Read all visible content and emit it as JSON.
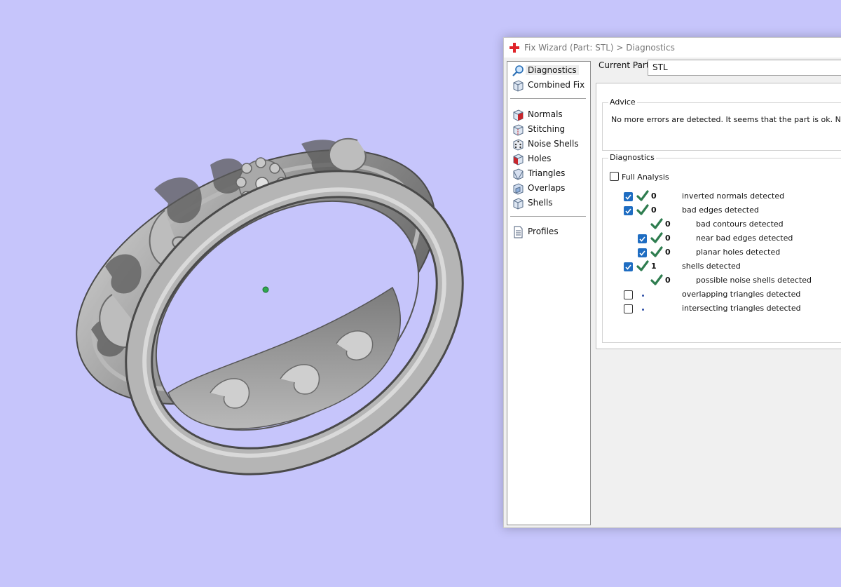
{
  "window": {
    "title": "Fix Wizard (Part: STL) > Diagnostics",
    "title_icon": "red-cross-icon"
  },
  "nav": {
    "items": [
      {
        "label": "Diagnostics",
        "icon": "magnifier-icon",
        "selected": true
      },
      {
        "label": "Combined Fix",
        "icon": "cube-icon",
        "selected": false
      },
      {
        "label": "Normals",
        "icon": "cube-red-face-icon",
        "selected": false
      },
      {
        "label": "Stitching",
        "icon": "cube-stitch-icon",
        "selected": false
      },
      {
        "label": "Noise Shells",
        "icon": "dice-icon",
        "selected": false
      },
      {
        "label": "Holes",
        "icon": "cube-hole-icon",
        "selected": false
      },
      {
        "label": "Triangles",
        "icon": "triangle-cube-icon",
        "selected": false
      },
      {
        "label": "Overlaps",
        "icon": "overlap-cube-icon",
        "selected": false
      },
      {
        "label": "Shells",
        "icon": "shell-cube-icon",
        "selected": false
      },
      {
        "label": "Profiles",
        "icon": "document-icon",
        "selected": false
      }
    ]
  },
  "current_part": {
    "label": "Current Part:",
    "value": "STL"
  },
  "advice": {
    "title": "Advice",
    "text": "No more errors are detected. It seems that the part is ok. Note that"
  },
  "diagnostics": {
    "title": "Diagnostics",
    "full_analysis": {
      "label": "Full Analysis",
      "checked": false
    },
    "rows": [
      {
        "checkbox": true,
        "checked": true,
        "status": "ok",
        "count": "0",
        "label": "inverted normals detected",
        "indent": 0
      },
      {
        "checkbox": true,
        "checked": true,
        "status": "ok",
        "count": "0",
        "label": "bad edges detected",
        "indent": 0
      },
      {
        "checkbox": false,
        "checked": false,
        "status": "ok",
        "count": "0",
        "label": "bad contours detected",
        "indent": 1
      },
      {
        "checkbox": true,
        "checked": true,
        "status": "ok",
        "count": "0",
        "label": "near bad edges detected",
        "indent": 1
      },
      {
        "checkbox": true,
        "checked": true,
        "status": "ok",
        "count": "0",
        "label": "planar holes detected",
        "indent": 1
      },
      {
        "checkbox": true,
        "checked": true,
        "status": "ok",
        "count": "1",
        "label": "shells detected",
        "indent": 0
      },
      {
        "checkbox": false,
        "checked": false,
        "status": "ok",
        "count": "0",
        "label": "possible noise shells detected",
        "indent": 1
      },
      {
        "checkbox": true,
        "checked": false,
        "status": "pending",
        "count": "",
        "label": "overlapping triangles detected",
        "indent": 0
      },
      {
        "checkbox": true,
        "checked": false,
        "status": "pending",
        "count": "",
        "label": "intersecting triangles detected",
        "indent": 0
      }
    ]
  },
  "colors": {
    "background": "#c6c5fb",
    "check_green": "#2e7d4f",
    "checkbox_blue": "#1f6dc2",
    "ring_metal": "#9a9a9a"
  }
}
